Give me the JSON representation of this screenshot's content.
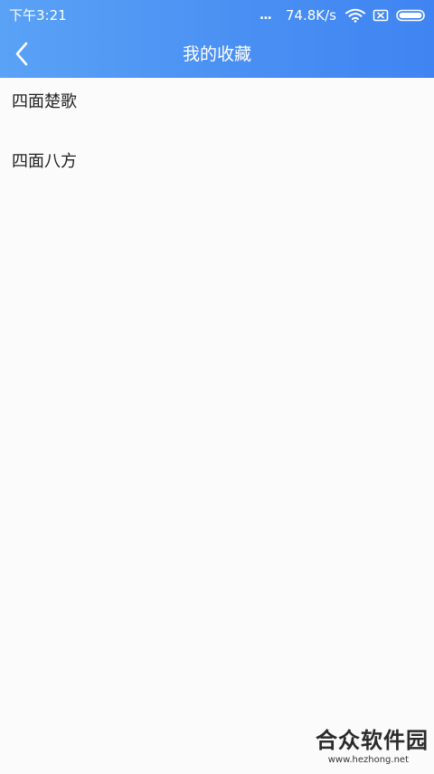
{
  "status_bar": {
    "time": "下午3:21",
    "dots": "...",
    "network_speed": "74.8K/s",
    "icons": [
      "wifi-icon",
      "sim-x-icon",
      "battery-icon"
    ]
  },
  "app_bar": {
    "back_icon": "chevron-left-icon",
    "title": "我的收藏"
  },
  "favorites": {
    "items": [
      {
        "label": "四面楚歌"
      },
      {
        "label": "四面八方"
      }
    ]
  },
  "watermark": {
    "name": "合众软件园",
    "url": "www.hezhong.net"
  },
  "colors": {
    "header_start": "#5aa2f6",
    "header_end": "#3f84f2",
    "background": "#fbfbfb",
    "text": "#222222"
  }
}
